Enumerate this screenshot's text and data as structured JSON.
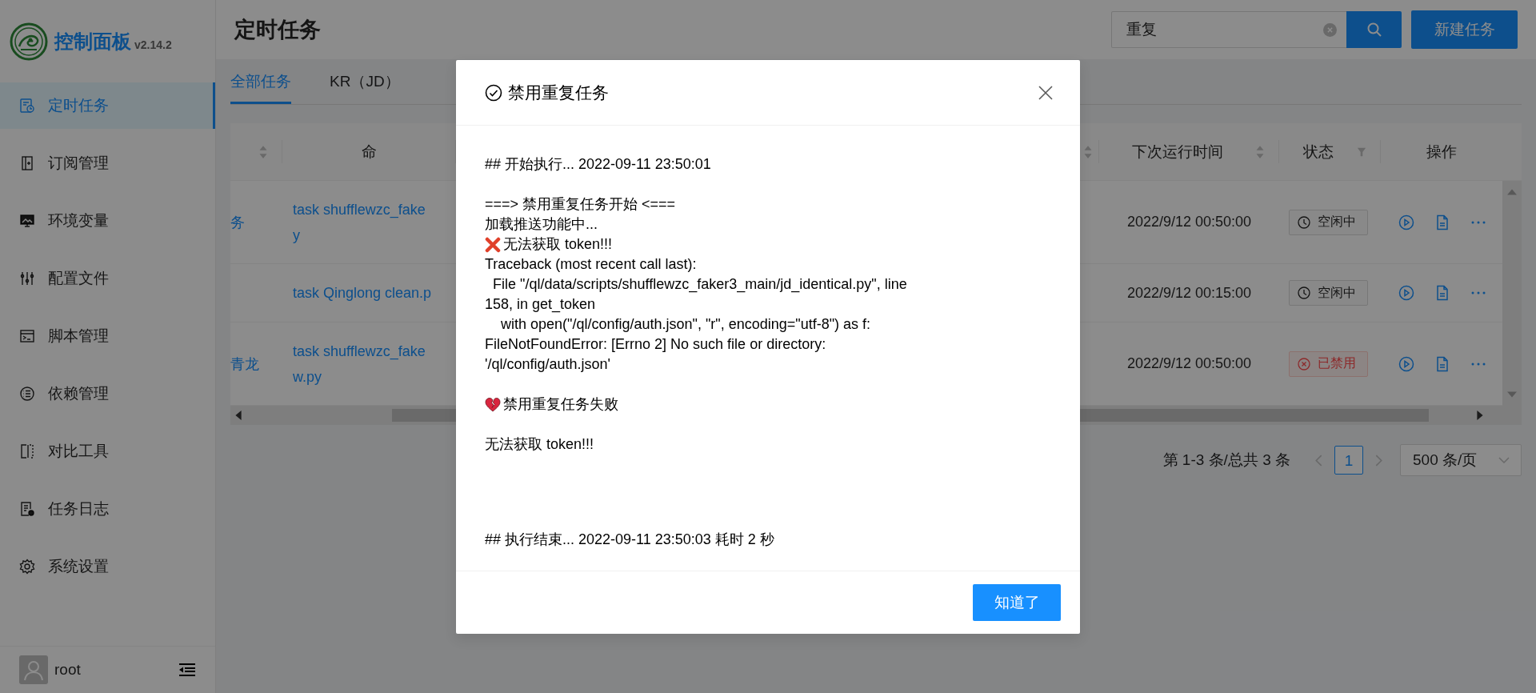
{
  "sidebar": {
    "logo_title": "控制面板",
    "version": "v2.14.2",
    "items": [
      {
        "label": "定时任务",
        "selected": true
      },
      {
        "label": "订阅管理",
        "selected": false
      },
      {
        "label": "环境变量",
        "selected": false
      },
      {
        "label": "配置文件",
        "selected": false
      },
      {
        "label": "脚本管理",
        "selected": false
      },
      {
        "label": "依赖管理",
        "selected": false
      },
      {
        "label": "对比工具",
        "selected": false
      },
      {
        "label": "任务日志",
        "selected": false
      },
      {
        "label": "系统设置",
        "selected": false
      }
    ],
    "user": "root"
  },
  "header": {
    "title": "定时任务",
    "search": {
      "value": "重复"
    },
    "new_button": "新建任务"
  },
  "tabs": [
    {
      "label": "全部任务",
      "selected": true
    },
    {
      "label": "KR（JD）",
      "selected": false
    }
  ],
  "table": {
    "columns": [
      {
        "kind": "sortable"
      },
      {
        "label": "命",
        "kind": "plain"
      },
      {
        "kind": "sortable"
      },
      {
        "label": "下次运行时间",
        "kind": "sortable"
      },
      {
        "label": "状态",
        "kind": "filterable"
      },
      {
        "label": "操作",
        "kind": "plain"
      }
    ],
    "rows": [
      {
        "name": "务",
        "command": [
          "task shufflewzc_fake",
          "y"
        ],
        "next_run": "2022/9/12 00:50:00",
        "status": {
          "text": "空闲中",
          "kind": "idle"
        }
      },
      {
        "command": [
          "task Qinglong clean.p"
        ],
        "next_run": "2022/9/12 00:15:00",
        "status": {
          "text": "空闲中",
          "kind": "idle"
        }
      },
      {
        "name": "青龙",
        "command": [
          "task shufflewzc_fake",
          "w.py"
        ],
        "next_run": "2022/9/12 00:50:00",
        "status": {
          "text": "已禁用",
          "kind": "disabled"
        }
      }
    ]
  },
  "pagination": {
    "summary": "第 1-3 条/总共 3 条",
    "pages": [
      {
        "label": "1",
        "selected": true
      }
    ],
    "page_size": "500 条/页"
  },
  "modal": {
    "title": "禁用重复任务",
    "blocks": [
      [
        {
          "kind": "plain",
          "text": "## 开始执行... 2022-09-11 23:50:01"
        }
      ],
      [
        {
          "kind": "plain",
          "text": "===> 禁用重复任务开始 <==="
        },
        {
          "kind": "plain",
          "text": "加载推送功能中..."
        },
        {
          "kind": "error",
          "text": "无法获取 token!!!"
        },
        {
          "kind": "plain",
          "text": "Traceback (most recent call last):"
        },
        {
          "kind": "plain",
          "text": "  File \"/ql/data/scripts/shufflewzc_faker3_main/jd_identical.py\", line"
        },
        {
          "kind": "plain",
          "text": "158, in get_token"
        },
        {
          "kind": "plain",
          "text": "    with open(\"/ql/config/auth.json\", \"r\", encoding=\"utf-8\") as f:"
        },
        {
          "kind": "plain",
          "text": "FileNotFoundError: [Errno 2] No such file or directory:"
        },
        {
          "kind": "plain",
          "text": "'/ql/config/auth.json'"
        }
      ],
      [
        {
          "kind": "fail",
          "text": "禁用重复任务失败"
        }
      ],
      [
        {
          "kind": "plain",
          "text": "无法获取 token!!!"
        }
      ]
    ],
    "end": "## 执行结束... 2022-09-11 23:50:03 耗时 2 秒",
    "ok_button": "知道了"
  }
}
